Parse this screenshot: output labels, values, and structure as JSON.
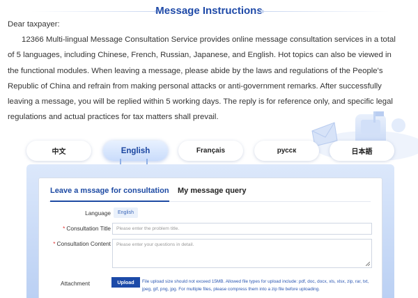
{
  "header": {
    "title": "Message Instructions"
  },
  "intro": {
    "greeting": "Dear taxpayer:",
    "body": "12366 Multi-lingual Message Consultation Service provides online message consultation services in a total of 5 languages, including Chinese, French, Russian, Japanese, and English. Hot topics can also be viewed in the functional modules. When leaving a message, please abide by the laws and regulations of the People's Republic of China and refrain from making personal attacks or anti-government remarks. After successfully leaving a message, you will be replied within 5 working days. The reply is for reference only, and specific legal regulations and actual practices for tax matters shall prevail."
  },
  "language_tabs": [
    {
      "label": "中文",
      "active": false
    },
    {
      "label": "English",
      "active": true
    },
    {
      "label": "Français",
      "active": false
    },
    {
      "label": "русск",
      "active": false
    },
    {
      "label": "日本語",
      "active": false
    }
  ],
  "form": {
    "tabs": {
      "leave": "Leave a mssage for consultation",
      "query": "My message query"
    },
    "language_label": "Language",
    "language_value": "English",
    "title_label": "Consultation Title",
    "title_placeholder": "Please enter the problem title.",
    "content_label": "Consultation Content",
    "content_placeholder": "Please enter your questions  in detail.",
    "attachment_label": "Attachment",
    "upload_label": "Upload",
    "upload_hint": "File upload size should not exceed 15MB. Allowed file types for upload include: pdf, doc, docx, xls, xlsx, zip, rar, txt, jpeg, gif, png, jpg. For multiple files, please compress them into a zip file before uploading.",
    "required_mark": "*"
  },
  "colors": {
    "accent": "#1c4aa8",
    "panel": "#c9dcfb",
    "required": "#e03131"
  }
}
